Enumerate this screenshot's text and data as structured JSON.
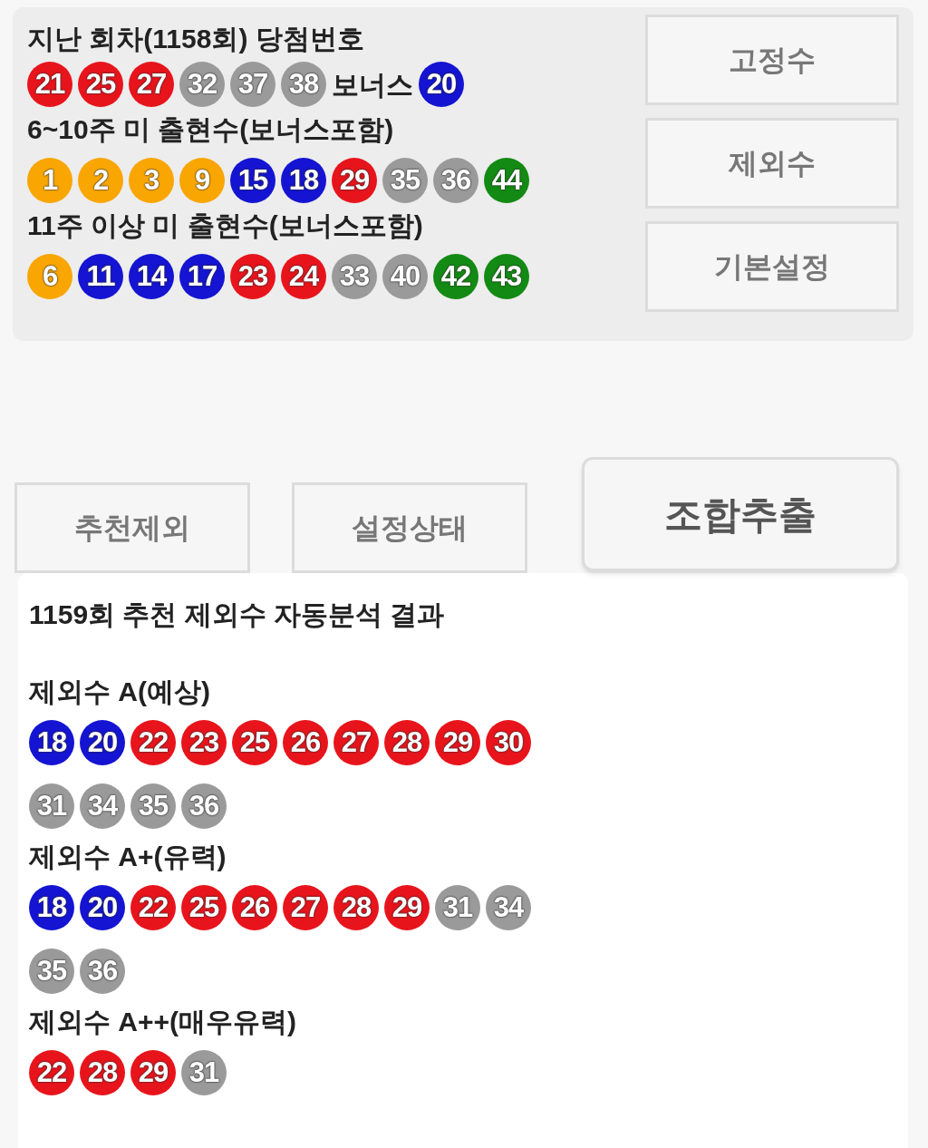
{
  "last_draw": {
    "title": "지난 회차(1158회) 당첨번호",
    "balls": [
      {
        "n": "21",
        "color": "#e8141c"
      },
      {
        "n": "25",
        "color": "#e8141c"
      },
      {
        "n": "27",
        "color": "#e8141c"
      },
      {
        "n": "32",
        "color": "#9a9a9a"
      },
      {
        "n": "37",
        "color": "#9a9a9a"
      },
      {
        "n": "38",
        "color": "#9a9a9a"
      }
    ],
    "bonus_label": "보너스",
    "bonus_ball": {
      "n": "20",
      "color": "#1414d2"
    }
  },
  "groups": [
    {
      "title": "6~10주 미 출현수(보너스포함)",
      "balls": [
        {
          "n": "1",
          "color": "#f9a602"
        },
        {
          "n": "2",
          "color": "#f9a602"
        },
        {
          "n": "3",
          "color": "#f9a602"
        },
        {
          "n": "9",
          "color": "#f9a602"
        },
        {
          "n": "15",
          "color": "#1414d2"
        },
        {
          "n": "18",
          "color": "#1414d2"
        },
        {
          "n": "29",
          "color": "#e8141c"
        },
        {
          "n": "35",
          "color": "#9a9a9a"
        },
        {
          "n": "36",
          "color": "#9a9a9a"
        },
        {
          "n": "44",
          "color": "#138a13"
        }
      ]
    },
    {
      "title": "11주 이상 미 출현수(보너스포함)",
      "balls": [
        {
          "n": "6",
          "color": "#f9a602"
        },
        {
          "n": "11",
          "color": "#1414d2"
        },
        {
          "n": "14",
          "color": "#1414d2"
        },
        {
          "n": "17",
          "color": "#1414d2"
        },
        {
          "n": "23",
          "color": "#e8141c"
        },
        {
          "n": "24",
          "color": "#e8141c"
        },
        {
          "n": "33",
          "color": "#9a9a9a"
        },
        {
          "n": "40",
          "color": "#9a9a9a"
        },
        {
          "n": "42",
          "color": "#138a13"
        },
        {
          "n": "43",
          "color": "#138a13"
        }
      ]
    }
  ],
  "side_buttons": [
    "고정수",
    "제외수",
    "기본설정"
  ],
  "action_buttons": [
    {
      "label": "추천제외",
      "kind": "normal"
    },
    {
      "label": "설정상태",
      "kind": "normal"
    },
    {
      "label": "조합추출",
      "kind": "primary"
    }
  ],
  "result": {
    "title": "1159회 추천 제외수 자동분석 결과",
    "sets": [
      {
        "title": "제외수 A(예상)",
        "balls": [
          {
            "n": "18",
            "color": "#1414d2"
          },
          {
            "n": "20",
            "color": "#1414d2"
          },
          {
            "n": "22",
            "color": "#e8141c"
          },
          {
            "n": "23",
            "color": "#e8141c"
          },
          {
            "n": "25",
            "color": "#e8141c"
          },
          {
            "n": "26",
            "color": "#e8141c"
          },
          {
            "n": "27",
            "color": "#e8141c"
          },
          {
            "n": "28",
            "color": "#e8141c"
          },
          {
            "n": "29",
            "color": "#e8141c"
          },
          {
            "n": "30",
            "color": "#e8141c"
          },
          {
            "n": "31",
            "color": "#9a9a9a"
          },
          {
            "n": "34",
            "color": "#9a9a9a"
          },
          {
            "n": "35",
            "color": "#9a9a9a"
          },
          {
            "n": "36",
            "color": "#9a9a9a"
          }
        ]
      },
      {
        "title": "제외수 A+(유력)",
        "balls": [
          {
            "n": "18",
            "color": "#1414d2"
          },
          {
            "n": "20",
            "color": "#1414d2"
          },
          {
            "n": "22",
            "color": "#e8141c"
          },
          {
            "n": "25",
            "color": "#e8141c"
          },
          {
            "n": "26",
            "color": "#e8141c"
          },
          {
            "n": "27",
            "color": "#e8141c"
          },
          {
            "n": "28",
            "color": "#e8141c"
          },
          {
            "n": "29",
            "color": "#e8141c"
          },
          {
            "n": "31",
            "color": "#9a9a9a"
          },
          {
            "n": "34",
            "color": "#9a9a9a"
          },
          {
            "n": "35",
            "color": "#9a9a9a"
          },
          {
            "n": "36",
            "color": "#9a9a9a"
          }
        ]
      },
      {
        "title": "제외수 A++(매우유력)",
        "balls": [
          {
            "n": "22",
            "color": "#e8141c"
          },
          {
            "n": "28",
            "color": "#e8141c"
          },
          {
            "n": "29",
            "color": "#e8141c"
          },
          {
            "n": "31",
            "color": "#9a9a9a"
          }
        ]
      }
    ]
  }
}
